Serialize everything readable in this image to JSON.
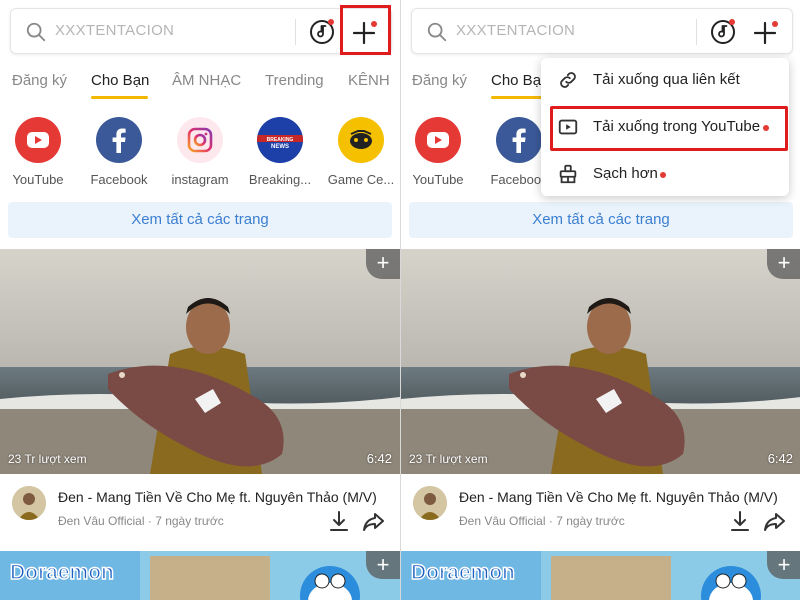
{
  "search": {
    "placeholder": "XXXTENTACION"
  },
  "tabs": [
    {
      "label": "Đăng ký"
    },
    {
      "label": "Cho Bạn"
    },
    {
      "label": "ÂM NHẠC"
    },
    {
      "label": "Trending"
    },
    {
      "label": "KÊNH"
    }
  ],
  "shortcuts": [
    {
      "label": "YouTube",
      "icon": "youtube-icon"
    },
    {
      "label": "Facebook",
      "icon": "facebook-icon"
    },
    {
      "label": "instagram",
      "icon": "instagram-icon"
    },
    {
      "label": "Breaking...",
      "icon": "breaking-news-icon",
      "badge": "BREAKING NEWS"
    },
    {
      "label": "Game Ce...",
      "icon": "game-center-icon"
    }
  ],
  "see_all_label": "Xem tất cả các trang",
  "video": {
    "views": "23 Tr lượt xem",
    "duration": "6:42",
    "title": "Đen - Mang Tiền Về Cho Mẹ ft. Nguyên Thảo (M/V)",
    "channel": "Đen Vâu Official",
    "age": "7 ngày trước",
    "separator": "·"
  },
  "second_thumbnail": {
    "text": "Doraemon"
  },
  "menu": {
    "items": [
      {
        "label": "Tải xuống qua liên kết",
        "icon": "link-icon",
        "dot": false
      },
      {
        "label": "Tải xuống trong YouTube",
        "icon": "youtube-play-icon",
        "dot": true
      },
      {
        "label": "Sạch hơn",
        "icon": "cleaner-icon",
        "dot": true
      }
    ]
  },
  "colors": {
    "accent_tab": "#f5b800",
    "link_blue": "#3b7fd0",
    "highlight_red": "#e01b1b",
    "notification_dot": "#e53935"
  }
}
